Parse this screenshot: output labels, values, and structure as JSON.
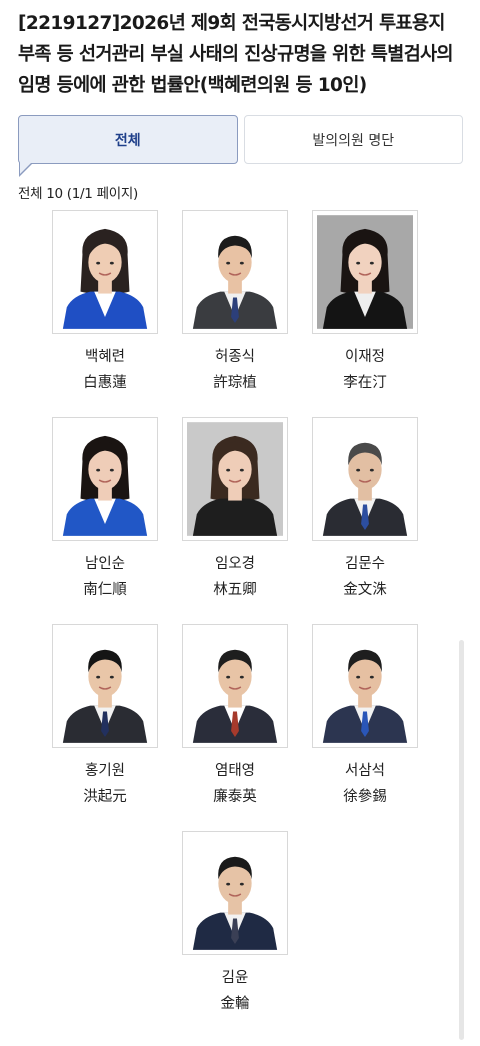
{
  "bill": {
    "title": "[2219127]2026년 제9회 전국동시지방선거 투표용지 부족 등 선거관리 부실 사태의 진상규명을 위한 특별검사의 임명 등에에 관한 법률안(백혜련의원 등 10인)"
  },
  "tabs": [
    {
      "label": "전체",
      "active": true
    },
    {
      "label": "발의의원 명단",
      "active": false
    }
  ],
  "count_text": "전체 10 (1/1 페이지)",
  "members": [
    {
      "name_ko": "백혜련",
      "name_hanja": "白惠蓮",
      "photo": {
        "bg": "#ffffff",
        "suit": "#1f4fc4",
        "shirt": "#ffffff",
        "hair": "#2a2220",
        "skin": "#efcdb4",
        "gender": "f"
      }
    },
    {
      "name_ko": "허종식",
      "name_hanja": "許琮植",
      "photo": {
        "bg": "#ffffff",
        "suit": "#3a3c40",
        "shirt": "#f0f0f0",
        "hair": "#1c1c1c",
        "skin": "#e8c2a4",
        "gender": "m",
        "tie": "#2c3f7a"
      }
    },
    {
      "name_ko": "이재정",
      "name_hanja": "李在汀",
      "photo": {
        "bg": "#a8a8a8",
        "suit": "#141414",
        "shirt": "#eeeeee",
        "hair": "#1a1412",
        "skin": "#f1d2bf",
        "gender": "f"
      }
    },
    {
      "name_ko": "남인순",
      "name_hanja": "南仁順",
      "photo": {
        "bg": "#ffffff",
        "suit": "#2157c6",
        "shirt": "#ffffff",
        "hair": "#1a1412",
        "skin": "#efcdb8",
        "gender": "f"
      }
    },
    {
      "name_ko": "임오경",
      "name_hanja": "林五卿",
      "photo": {
        "bg": "#c9c9c9",
        "suit": "#1e1e1e",
        "shirt": "#1e1e1e",
        "hair": "#3b2a20",
        "skin": "#efcdb8",
        "gender": "f"
      }
    },
    {
      "name_ko": "김문수",
      "name_hanja": "金文洙",
      "photo": {
        "bg": "#ffffff",
        "suit": "#2a2c33",
        "shirt": "#f2f2f2",
        "hair": "#4a4a4a",
        "skin": "#e2bfa3",
        "gender": "m",
        "tie": "#2c4ea0"
      }
    },
    {
      "name_ko": "홍기원",
      "name_hanja": "洪起元",
      "photo": {
        "bg": "#ffffff",
        "suit": "#2a2c33",
        "shirt": "#f2f2f2",
        "hair": "#151515",
        "skin": "#e9c6a8",
        "gender": "m",
        "tie": "#22305e"
      }
    },
    {
      "name_ko": "염태영",
      "name_hanja": "廉泰英",
      "photo": {
        "bg": "#ffffff",
        "suit": "#2a2d3a",
        "shirt": "#ffffff",
        "hair": "#1e1e1e",
        "skin": "#e8c4a6",
        "gender": "m",
        "tie": "#a63a2c"
      }
    },
    {
      "name_ko": "서삼석",
      "name_hanja": "徐參錫",
      "photo": {
        "bg": "#ffffff",
        "suit": "#2c3550",
        "shirt": "#f2f2f2",
        "hair": "#1e1e1e",
        "skin": "#e6c0a2",
        "gender": "m",
        "tie": "#2a56b8"
      }
    },
    {
      "name_ko": "김윤",
      "name_hanja": "金輪",
      "photo": {
        "bg": "#ffffff",
        "suit": "#1f2a44",
        "shirt": "#f2f2f2",
        "hair": "#1a1a1a",
        "skin": "#e6c3a6",
        "gender": "m",
        "tie": "#3a3f55"
      }
    }
  ]
}
